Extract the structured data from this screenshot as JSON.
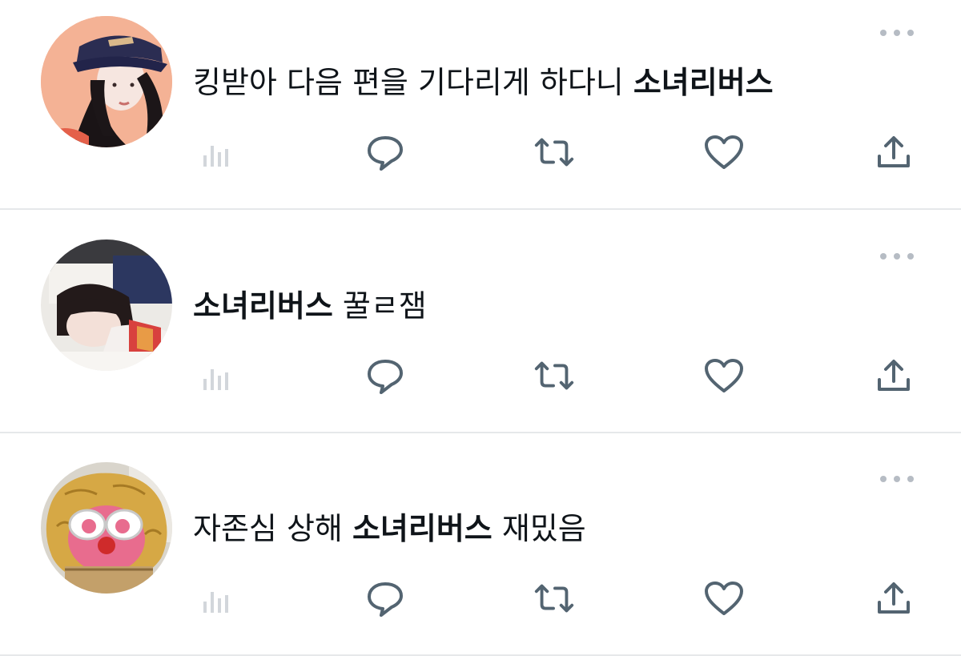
{
  "tweets": [
    {
      "avatar_description": "woman wearing navy cap",
      "text": {
        "prefix": "킹받아 다음 편을 기다리게 하다니 ",
        "hashtag": "소녀리버스",
        "suffix": ""
      }
    },
    {
      "avatar_description": "girl with bangs resting head",
      "text": {
        "prefix": "",
        "hashtag": "소녀리버스",
        "suffix": " 꿀ㄹ잼"
      }
    },
    {
      "avatar_description": "yellow plush character with white sunglasses",
      "text": {
        "prefix": "자존심 상해 ",
        "hashtag": "소녀리버스",
        "suffix": " 재밌음"
      }
    }
  ],
  "icons": {
    "more": "more-horizontal-icon",
    "stats": "bar-chart-icon",
    "reply": "speech-bubble-icon",
    "retweet": "retweet-icon",
    "like": "heart-icon",
    "share": "share-upload-icon"
  },
  "colors": {
    "icon": "#536471",
    "stats_icon": "#d2d6db",
    "more_dots": "#b6bcc4",
    "divider": "#e6e8ea",
    "text": "#0f1419"
  }
}
